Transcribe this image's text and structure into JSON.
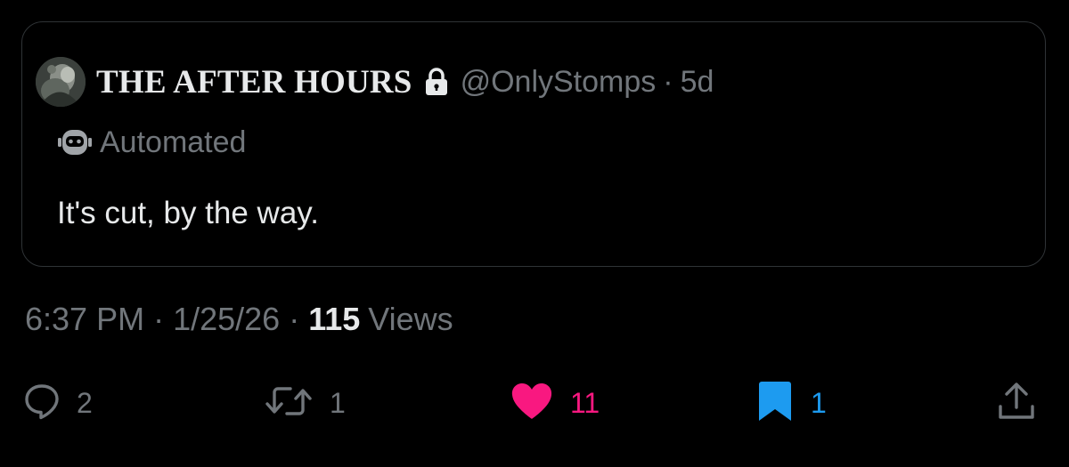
{
  "quoted_post": {
    "display_name": "THE AFTER HOURS",
    "handle": "@OnlyStomps",
    "separator": "·",
    "time_ago": "5d",
    "automated_label": "Automated",
    "text": "It's cut, by the way.",
    "icons": {
      "avatar": "avatar",
      "lock": "lock-icon",
      "bot": "bot-icon"
    }
  },
  "post_meta": {
    "time": "6:37 PM",
    "separator": "·",
    "date": "1/25/26",
    "views_count": "115",
    "views_label": "Views"
  },
  "actions": {
    "reply": {
      "icon": "reply-icon",
      "count": "2"
    },
    "retweet": {
      "icon": "retweet-icon",
      "count": "1"
    },
    "like": {
      "icon": "heart-icon",
      "count": "11",
      "active": true
    },
    "bookmark": {
      "icon": "bookmark-icon",
      "count": "1",
      "active": true
    },
    "share": {
      "icon": "share-icon"
    }
  },
  "colors": {
    "background": "#000000",
    "primary_text": "#e7e9ea",
    "secondary_text": "#71767b",
    "border": "#2f3336",
    "like": "#f91880",
    "bookmark": "#1d9bf0"
  }
}
